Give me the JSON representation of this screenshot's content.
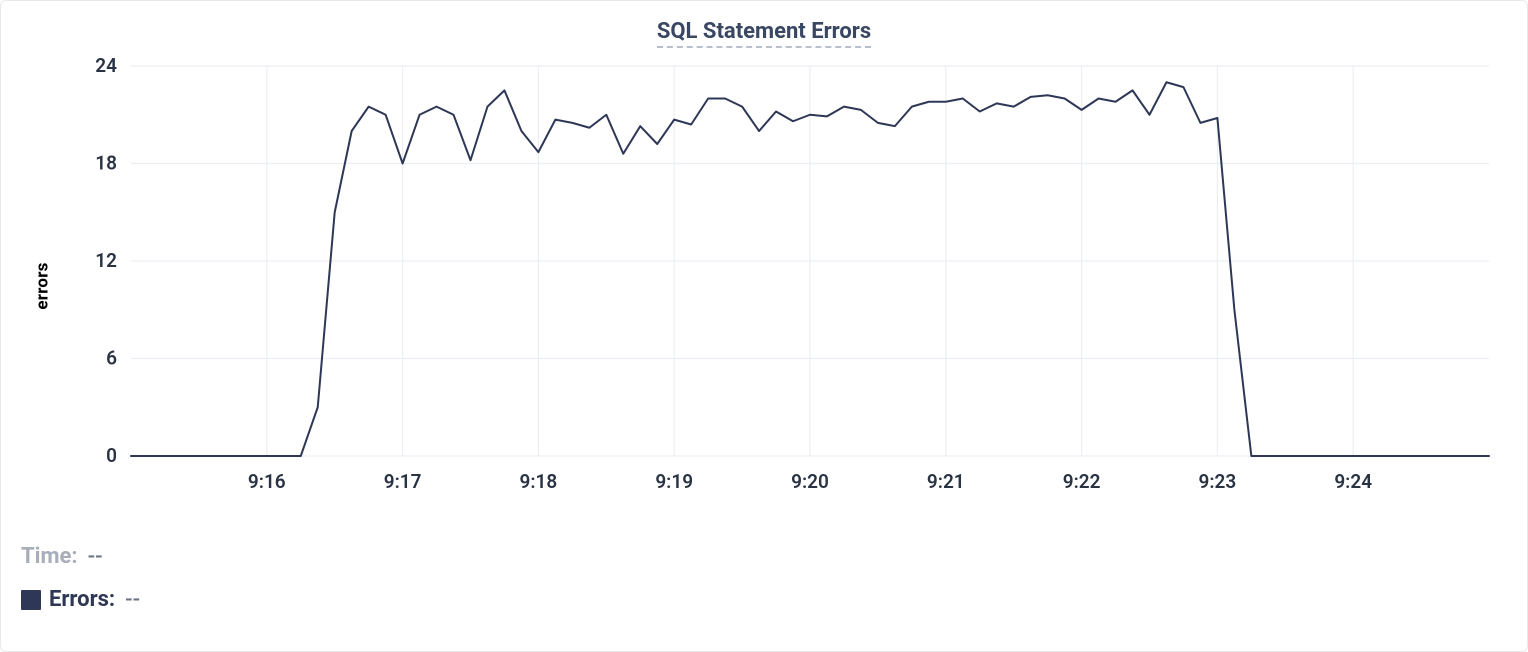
{
  "chart_data": {
    "type": "line",
    "title": "SQL Statement Errors",
    "ylabel": "errors",
    "ylim": [
      0,
      24
    ],
    "y_ticks": [
      0,
      6,
      12,
      18,
      24
    ],
    "x_ticks": [
      "9:16",
      "9:17",
      "9:18",
      "9:19",
      "9:20",
      "9:21",
      "9:22",
      "9:23",
      "9:24"
    ],
    "x_range_ticks": 10,
    "x_tick_start_index": 1,
    "series": [
      {
        "name": "Errors",
        "color": "#2e3856",
        "values": [
          0,
          0,
          0,
          0,
          0,
          0,
          0,
          0,
          0,
          0,
          0,
          3,
          15,
          20,
          21.5,
          21,
          18,
          21,
          21.5,
          21,
          18.2,
          21.5,
          22.5,
          20,
          18.7,
          20.7,
          20.5,
          20.2,
          21,
          18.6,
          20.3,
          19.2,
          20.7,
          20.4,
          22,
          22,
          21.5,
          20,
          21.2,
          20.6,
          21,
          20.9,
          21.5,
          21.3,
          20.5,
          20.3,
          21.5,
          21.8,
          21.8,
          22,
          21.2,
          21.7,
          21.5,
          22.1,
          22.2,
          22,
          21.3,
          22,
          21.8,
          22.5,
          21,
          23,
          22.7,
          20.5,
          20.8,
          9,
          0,
          0,
          0,
          0,
          0,
          0,
          0,
          0,
          0,
          0,
          0,
          0,
          0,
          0,
          0
        ]
      }
    ]
  },
  "footer": {
    "time_label": "Time:",
    "time_value": "--",
    "errors_label": "Errors:",
    "errors_value": "--"
  }
}
